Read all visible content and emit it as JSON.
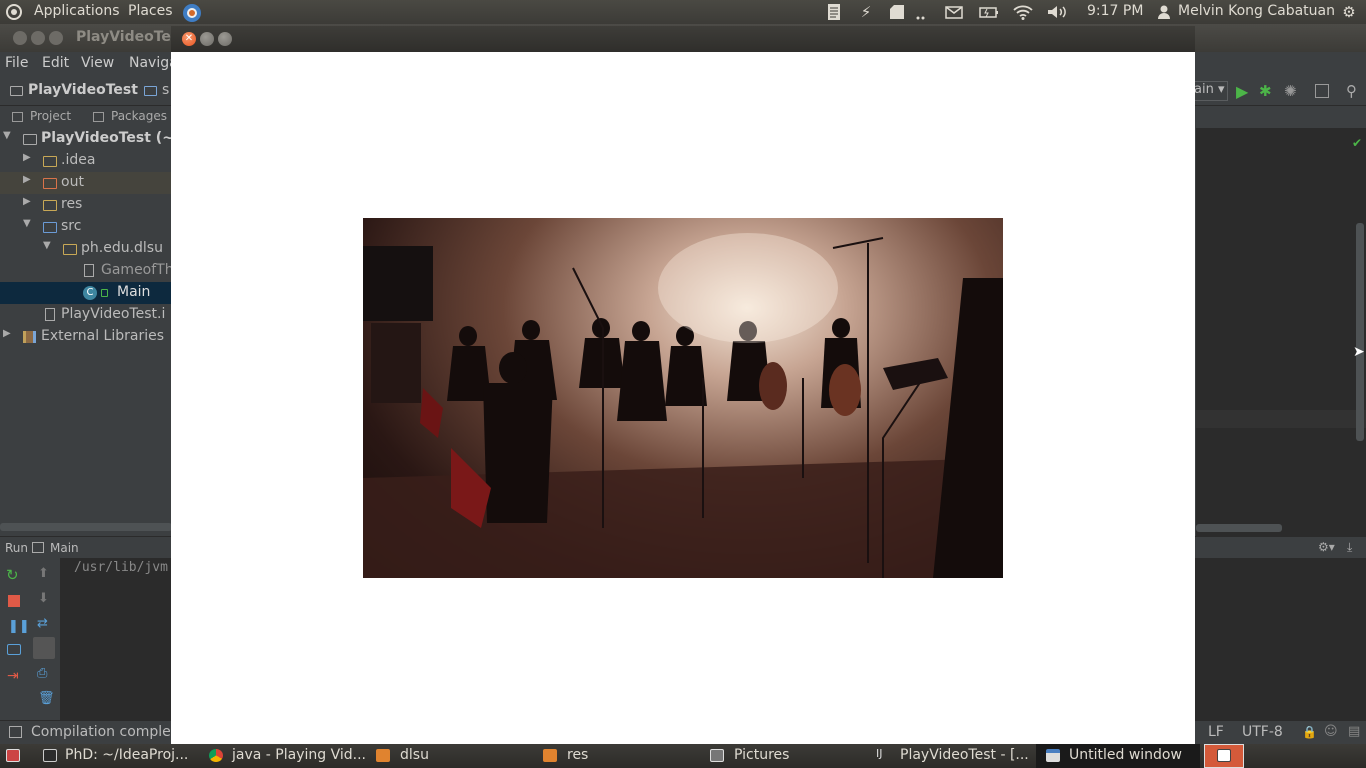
{
  "top_panel": {
    "menu_applications": "Applications",
    "menu_places": "Places",
    "clock": "9:17 PM",
    "user": "Melvin Kong Cabatuan"
  },
  "ide": {
    "window_title": "PlayVideoTes",
    "menu": [
      "File",
      "Edit",
      "View",
      "Naviga"
    ],
    "breadcrumb_project": "PlayVideoTest",
    "breadcrumb_next": "s",
    "run_config": "ain",
    "tab_project": "Project",
    "tab_packages": "Packages",
    "tree": {
      "root": "PlayVideoTest (~/I",
      "idea": ".idea",
      "out": "out",
      "res": "res",
      "src": "src",
      "package": "ph.edu.dlsu",
      "file1": "GameofTh",
      "main": "Main",
      "iml": "PlayVideoTest.i",
      "ext_libs": "External Libraries"
    },
    "run_label": "Run",
    "run_config_tab": "Main",
    "console_text": "/usr/lib/jvm",
    "status_text": "Compilation comple",
    "status_lf": "LF",
    "status_encoding": "UTF-8"
  },
  "video_window": {
    "title": ""
  },
  "taskbar": {
    "tasks": [
      "PhD: ~/IdeaProj...",
      "java - Playing Vid...",
      "dlsu",
      "res",
      "Pictures",
      "PlayVideoTest - [...",
      "Untitled window"
    ]
  },
  "colors": {
    "accent_folder": "#c8a856",
    "selected_row": "#0d293e",
    "close_button": "#e95420"
  }
}
